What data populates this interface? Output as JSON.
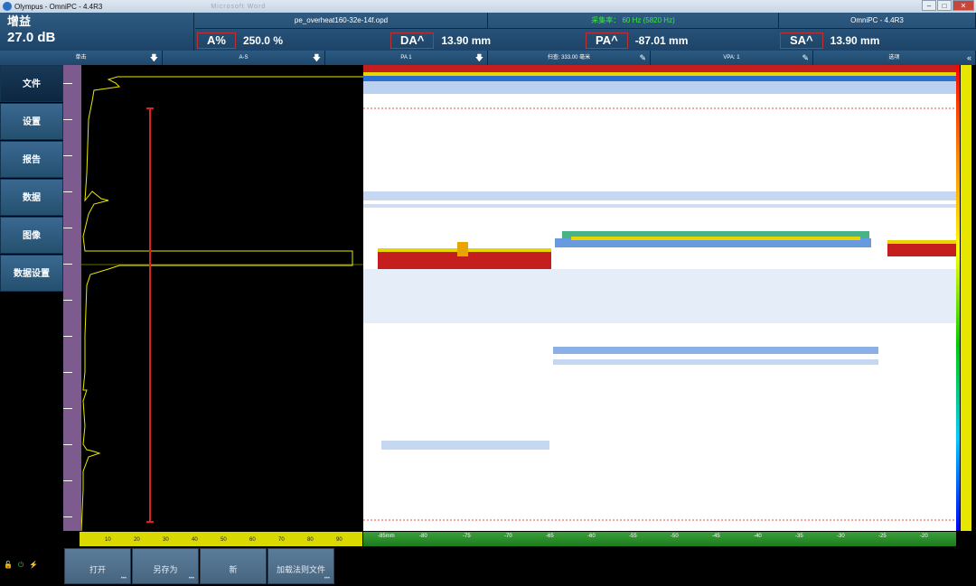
{
  "window": {
    "title": "Olympus - OmniPC - 4.4R3",
    "ghost_text": "Microsoft Word",
    "buttons": [
      "–",
      "□",
      "✕"
    ]
  },
  "header": {
    "gain_label": "增益",
    "gain_value": "27.0 dB",
    "file_name": "pe_overheat160-32e-14f.opd",
    "acq_rate": "采集率： 60 Hz (5820 Hz)",
    "app_version": "OmniPC - 4.4R3",
    "readouts": [
      {
        "key": "A%",
        "value": "250.0  %"
      },
      {
        "key": "DA^",
        "value": "13.90  mm"
      },
      {
        "key": "PA^",
        "value": "-87.01  mm"
      },
      {
        "key": "SA^",
        "value": "13.90  mm"
      }
    ]
  },
  "toolbar": {
    "items": [
      {
        "label": "单击",
        "icon": "down-arrow-icon"
      },
      {
        "label": "A-S",
        "icon": "down-arrow-icon"
      },
      {
        "label": "PA 1",
        "icon": "down-arrow-icon"
      },
      {
        "label": "扫查: 333.00 毫米",
        "icon": "pencil-icon"
      },
      {
        "label": "VPA: 1",
        "icon": "pencil-icon"
      },
      {
        "label": "选项",
        "icon": "double-chevron-icon"
      }
    ]
  },
  "sidebar": {
    "items": [
      {
        "label": "文件",
        "active": true
      },
      {
        "label": "设置"
      },
      {
        "label": "报告"
      },
      {
        "label": "数据"
      },
      {
        "label": "图像"
      },
      {
        "label": "数据设置"
      }
    ]
  },
  "ascan_ticks": [
    "10",
    "20",
    "30",
    "40",
    "50",
    "60",
    "70",
    "80",
    "90"
  ],
  "bscan_ticks": [
    "-85mm",
    "-80",
    "-75",
    "-70",
    "-65",
    "-60",
    "-55",
    "-50",
    "-45",
    "-40",
    "-35",
    "-30",
    "-25",
    "-20"
  ],
  "bottom": {
    "buttons": [
      {
        "label": "打开"
      },
      {
        "label": "另存为"
      },
      {
        "label": "新"
      },
      {
        "label": "加载法则文件"
      }
    ]
  },
  "colors": {
    "accent": "#1d4468",
    "cursor": "#e02020",
    "signal": "#e8e800"
  }
}
